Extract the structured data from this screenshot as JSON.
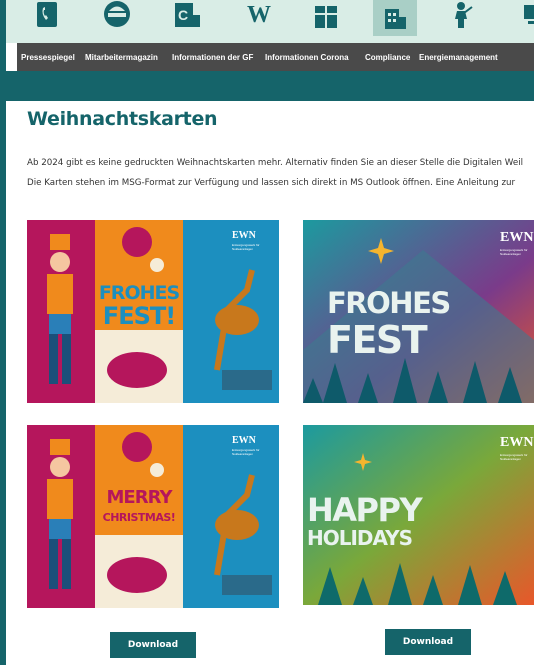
{
  "icon_bar": {
    "icons": [
      "phone-icon",
      "helmet-icon",
      "document-icon",
      "wiki-icon",
      "gift-icon",
      "building-icon",
      "worker-icon",
      "screen-icon"
    ],
    "wiki_glyph": "W"
  },
  "nav": {
    "items": [
      "Pressespiegel",
      "Mitarbeitermagazin",
      "Informationen der GF",
      "Informationen Corona",
      "Compliance",
      "Energiemanagement"
    ]
  },
  "page": {
    "title": "Weihnachtskarten",
    "intro_line1": "Ab 2024 gibt es keine gedruckten Weihnachtskarten mehr. Alternativ finden Sie an dieser Stelle die Digitalen Weil",
    "intro_line2": "Die Karten stehen im MSG-Format zur Verfügung und lassen sich direkt in MS Outlook öffnen. Eine Anleitung zur"
  },
  "cards": [
    {
      "greeting1": "FROHES",
      "greeting2": "FEST!",
      "logo": "EWN",
      "logo_sub": "Entsorgungswerk für Nuklearanlagen"
    },
    {
      "greeting1": "FROHES",
      "greeting2": "FEST",
      "logo": "EWN",
      "logo_sub": "Entsorgungswerk für Nuklearanlagen"
    },
    {
      "greeting1": "MERRY",
      "greeting2": "CHRISTMAS!",
      "logo": "EWN",
      "logo_sub": "Entsorgungswerk für Nuklearanlagen"
    },
    {
      "greeting1": "HAPPY",
      "greeting2": "HOLIDAYS",
      "logo": "EWN",
      "logo_sub": "Entsorgungswerk für Nuklearanlagen"
    }
  ],
  "downloads": {
    "label": "Download"
  },
  "colors": {
    "teal": "#15646a",
    "nav_bg": "#4a4a4a",
    "icon_bar_bg": "#d9ede6",
    "magenta": "#b5165c",
    "orange": "#f08a1c",
    "blue": "#1c8fbf"
  }
}
